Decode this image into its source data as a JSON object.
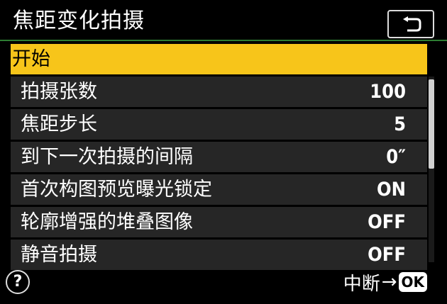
{
  "header": {
    "title": "焦距变化拍摄",
    "back_icon": "return-arrow-icon"
  },
  "menu": {
    "items": [
      {
        "label": "开始",
        "value": "",
        "selected": true
      },
      {
        "label": "拍摄张数",
        "value": "100"
      },
      {
        "label": "焦距步长",
        "value": "5"
      },
      {
        "label": "到下一次拍摄的间隔",
        "value": "0″"
      },
      {
        "label": "首次构图预览曝光锁定",
        "value": "ON"
      },
      {
        "label": "轮廓增强的堆叠图像",
        "value": "OFF"
      },
      {
        "label": "静音拍摄",
        "value": "OFF"
      }
    ]
  },
  "footer": {
    "help_symbol": "?",
    "hint_text": "中断",
    "arrow": "→",
    "ok_label": "OK"
  },
  "colors": {
    "selection": "#f7c51a",
    "row_background": "#262626",
    "header_underline": "#2e7d32"
  }
}
